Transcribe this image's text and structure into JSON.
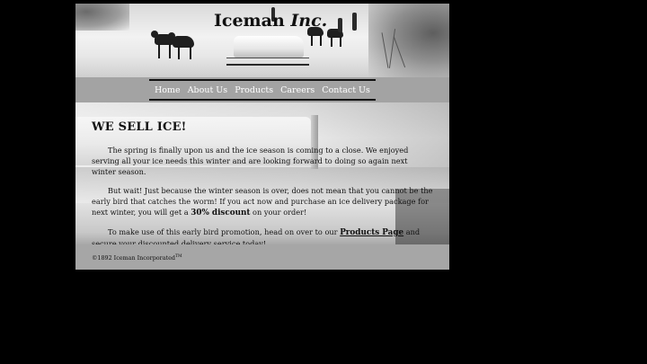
{
  "header": {
    "brand_main": "Iceman",
    "brand_italic": "Inc."
  },
  "nav": {
    "items": [
      {
        "label": "Home"
      },
      {
        "label": "About Us"
      },
      {
        "label": "Products"
      },
      {
        "label": "Careers"
      },
      {
        "label": "Contact Us"
      }
    ]
  },
  "main": {
    "heading": "WE SELL ICE!",
    "para1": "The spring is finally upon us and the ice season is coming to a close. We enjoyed serving all your ice needs this winter and are looking forward to doing so again next winter season.",
    "para2_before": "But wait! Just because the winter season is over, does not mean that you cannot be the early bird that catches the worm! If you act now and purchase an ice delivery package for next winter, you will get a ",
    "para2_discount": "30% discount",
    "para2_after": " on your order!",
    "para3_before": "To make use of this early bird promotion, head on over to our ",
    "para3_link": "Products Page",
    "para3_after": " and secure your discounted delivery service today!"
  },
  "footer": {
    "copyright": "©1892 Iceman Incorporated",
    "trademark": "TM"
  },
  "colors": {
    "page_background": "#000000",
    "nav_text": "#ffffff",
    "body_text": "#111111",
    "panel_gray": "#a9a9a9"
  }
}
